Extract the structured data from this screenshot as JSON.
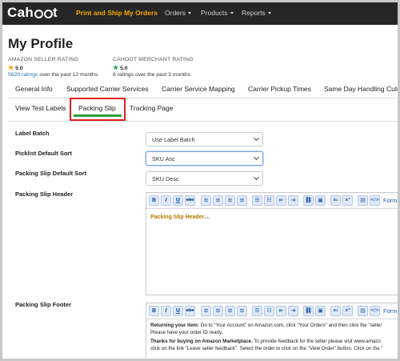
{
  "navbar": {
    "logo": "Cahoot",
    "items": [
      {
        "label": "Print and Ship My Orders",
        "active": true
      },
      {
        "label": "Orders",
        "dropdown": true
      },
      {
        "label": "Products",
        "dropdown": true
      },
      {
        "label": "Reports",
        "dropdown": true
      }
    ]
  },
  "page": {
    "title": "My Profile"
  },
  "ratings": {
    "amazon": {
      "label": "AMAZON SELLER RATING",
      "value": "5.0",
      "count_link": "5620 ratings",
      "period": "over the past 12 months"
    },
    "cahoot": {
      "label": "CAHOOT MERCHANT RATING",
      "value": "5.0",
      "summary": "6 ratings over the past 3 months"
    }
  },
  "tabs": [
    "General Info",
    "Supported Carrier Services",
    "Carrier Service Mapping",
    "Carrier Pickup Times",
    "Same Day Handling Cuto"
  ],
  "subtabs": [
    "View Test Labels",
    "Packing Slip",
    "Tracking Page"
  ],
  "form": {
    "label_batch": {
      "label": "Label Batch",
      "value": "Use Label Batch"
    },
    "picklist_sort": {
      "label": "Picklist Default Sort",
      "value": "SKU Asc"
    },
    "packing_slip_sort": {
      "label": "Packing Slip Default Sort",
      "value": "SKU Desc"
    },
    "packing_slip_header": {
      "label": "Packing Slip Header",
      "content": "Packing Slip Header...."
    },
    "packing_slip_footer": {
      "label": "Packing Slip Footer",
      "line1_bold": "Returning your item:",
      "line1_rest": " Go to \"Your Account\" on Amazon.com, click \"Your Orders\" and then click the \"seller",
      "line2": "Please have your order ID ready.",
      "line3_bold": "Thanks for buying on Amazon Marketplace.",
      "line3_rest": " To provide feedback for the seller please visit www.amazo",
      "line4": "click on the link \"Leave seller feedback\". Select the order to click on the \"View Order\" button. Click on the \""
    }
  },
  "toolbar": {
    "bold": "B",
    "italic": "I",
    "underline": "U",
    "strike": "abc",
    "align_left": "≡",
    "align_center": "≡",
    "align_right": "≡",
    "justify": "≡",
    "bullet_list": "☰",
    "numbered_list": "☷",
    "outdent": "⇤",
    "indent": "⇥",
    "link": "⛓",
    "image": "▣",
    "subscript": "x₂",
    "superscript": "x²",
    "hr": "▤",
    "source": "</>",
    "format": "Format"
  }
}
